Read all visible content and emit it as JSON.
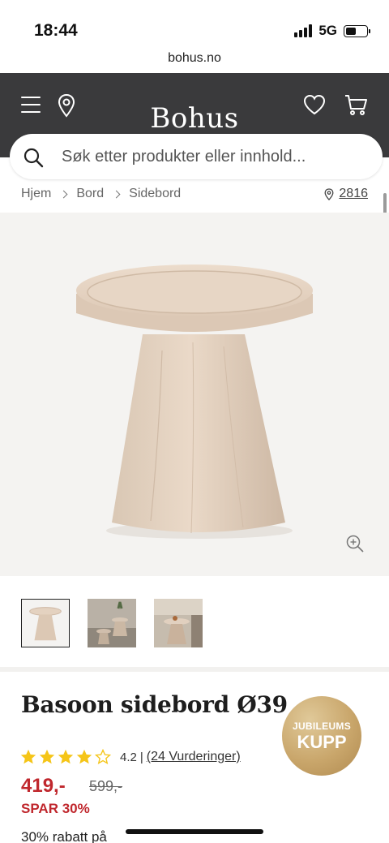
{
  "status": {
    "time": "18:44",
    "network": "5G",
    "battery_level": 0.5
  },
  "browser": {
    "url": "bohus.no"
  },
  "header": {
    "brand": "Bohus"
  },
  "search": {
    "placeholder": "Søk etter produkter eller innhold..."
  },
  "breadcrumb": {
    "items": [
      "Hjem",
      "Bord",
      "Sidebord"
    ],
    "store": "2816"
  },
  "gallery": {
    "thumbnail_count": 3,
    "active_index": 0
  },
  "product": {
    "title": "Basoon sidebord Ø39",
    "badge_line1": "JUBILEUMS",
    "badge_line2": "KUPP",
    "rating": "4.2",
    "rating_value": 4.2,
    "rating_separator": "|",
    "rating_count": "(24 Vurderinger)",
    "price": "419,-",
    "old_price": "599,-",
    "discount": "SPAR 30%",
    "promo": "30% rabatt på"
  },
  "colors": {
    "header_bg": "#3a3a3c",
    "accent_red": "#c0272d",
    "star": "#f5c518",
    "badge_gold": "#c9a66b"
  }
}
